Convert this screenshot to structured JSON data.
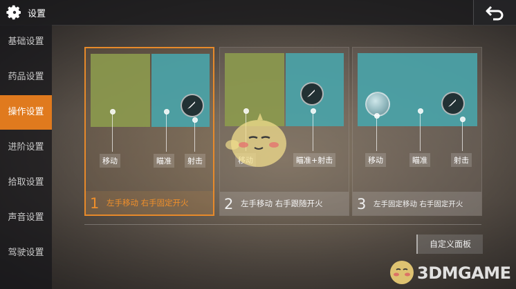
{
  "header": {
    "title": "设置",
    "gear_icon": "gear-icon",
    "back_icon": "back-arrow-icon"
  },
  "sidebar": {
    "items": [
      {
        "label": "基础设置",
        "active": false
      },
      {
        "label": "药品设置",
        "active": false
      },
      {
        "label": "操作设置",
        "active": true
      },
      {
        "label": "进阶设置",
        "active": false
      },
      {
        "label": "拾取设置",
        "active": false
      },
      {
        "label": "声音设置",
        "active": false
      },
      {
        "label": "驾驶设置",
        "active": false
      }
    ]
  },
  "schemes": [
    {
      "number": "1",
      "description": "左手移动 右手固定开火",
      "selected": true,
      "tags": [
        "移动",
        "瞄准",
        "射击"
      ]
    },
    {
      "number": "2",
      "description": "左手移动 右手跟随开火",
      "selected": false,
      "tags": [
        "移动",
        "瞄准+射击"
      ]
    },
    {
      "number": "3",
      "description": "左手固定移动 右手固定开火",
      "selected": false,
      "tags": [
        "移动",
        "瞄准",
        "射击"
      ]
    }
  ],
  "custom_panel_label": "自定义面板",
  "watermark": "3DMGAME",
  "colors": {
    "accent": "#e07a1e",
    "selected_border": "#e88a2a",
    "move_zone": "#8c9a4e",
    "aim_zone": "#4aa3a8"
  }
}
